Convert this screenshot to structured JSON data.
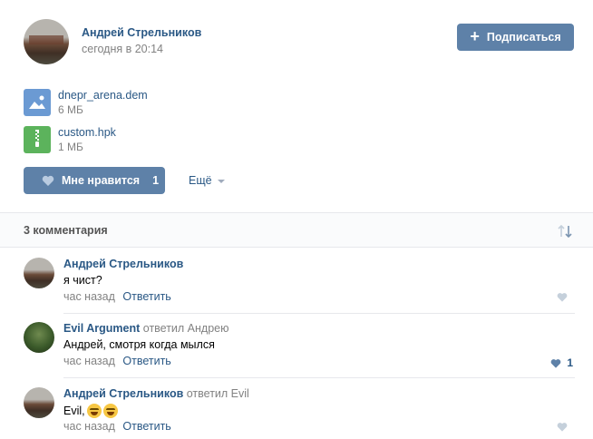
{
  "post": {
    "author": "Андрей Стрельников",
    "date": "сегодня в 20:14",
    "subscribe_label": "Подписаться"
  },
  "files": [
    {
      "name": "dnepr_arena.dem",
      "size": "6 МБ",
      "icon": "image-file-icon"
    },
    {
      "name": "custom.hpk",
      "size": "1 МБ",
      "icon": "archive-file-icon"
    }
  ],
  "actions": {
    "like_label": "Мне нравится",
    "like_count": "1",
    "more_label": "Ещё"
  },
  "comments_header": {
    "count_label": "3 комментария"
  },
  "comments": [
    {
      "author": "Андрей Стрельников",
      "reply_to": "",
      "text": "я чист?",
      "time": "час назад",
      "reply_label": "Ответить",
      "likes": ""
    },
    {
      "author": "Evil Argument",
      "reply_to": "ответил Андрею",
      "text": "Андрей, смотря когда мылся",
      "time": "час назад",
      "reply_label": "Ответить",
      "likes": "1"
    },
    {
      "author": "Андрей Стрельников",
      "reply_to": "ответил Evil",
      "text": "Evil,",
      "time": "час назад",
      "reply_label": "Ответить",
      "likes": ""
    }
  ],
  "colors": {
    "accent": "#5e81a8",
    "link": "#2a5885",
    "muted": "#828282"
  }
}
